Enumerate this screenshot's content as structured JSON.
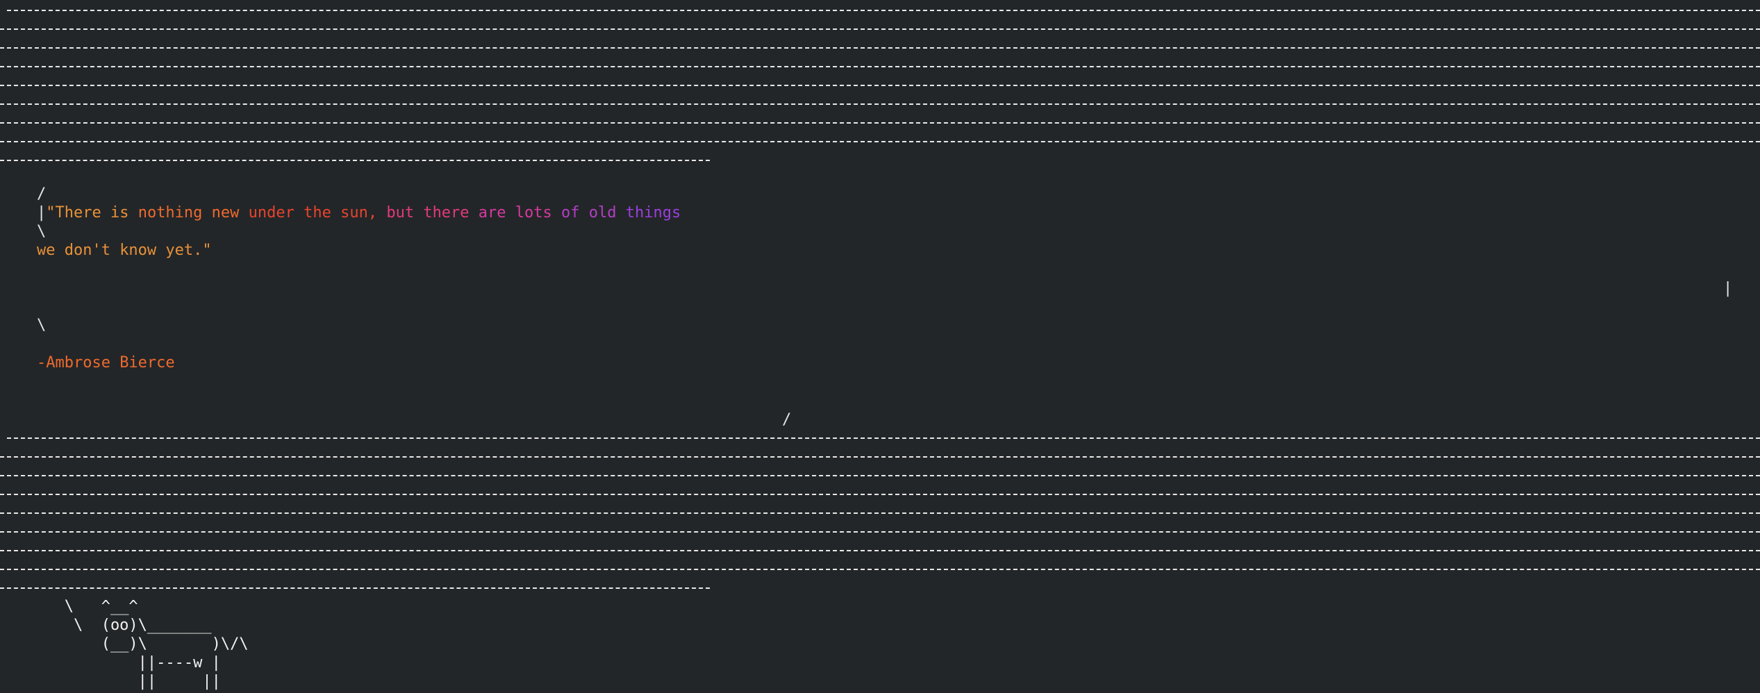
{
  "terminal": {
    "border_left_top": "/",
    "border_left_mid": "|",
    "border_left_bottom": "\\",
    "border_right_top": "\\",
    "border_right_mid": "|",
    "border_right_bottom": "/",
    "quote_line1_parts": [
      {
        "text": "\"There is",
        "color": "#e8913a"
      },
      {
        "text": " nothing new",
        "color": "#ee6a2e"
      },
      {
        "text": " under the sun,",
        "color": "#e8442e"
      },
      {
        "text": " but there",
        "color": "#e23a7a"
      },
      {
        "text": " are lots",
        "color": "#d63aa0"
      },
      {
        "text": " of old",
        "color": "#b43ec8"
      },
      {
        "text": " things",
        "color": "#9b3ee0"
      }
    ],
    "quote_line2": "we don't know yet.\"",
    "author": "-Ambrose Bierce",
    "cow": "       \\   ^__^\n        \\  (oo)\\_______\n           (__)\\       )\\/\\\n               ||----w |\n               ||     ||"
  },
  "colors": {
    "background": "#232628",
    "foreground": "#e6e6e6",
    "quote_line2": "#e8913a",
    "author": "#ee6a2e"
  }
}
